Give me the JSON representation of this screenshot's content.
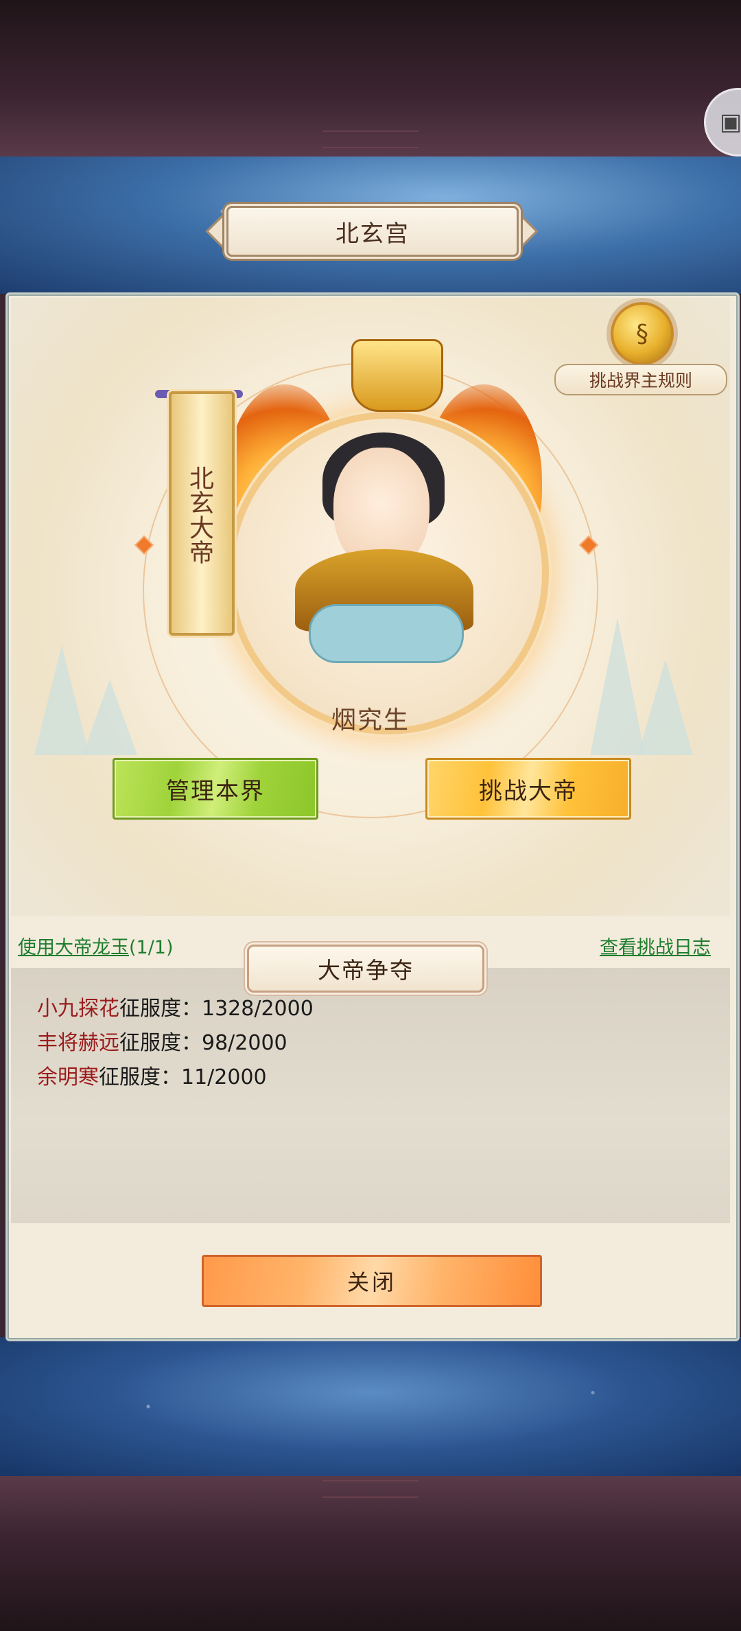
{
  "title": "北玄宫",
  "rules": {
    "icon": "scroll-rules-icon",
    "label": "挑战界主规则"
  },
  "ruler": {
    "title_banner": "北玄大帝",
    "name": "烟究生"
  },
  "actions": {
    "manage_label": "管理本界",
    "challenge_label": "挑战大帝"
  },
  "links": {
    "use_jade_label": "使用大帝龙玉",
    "use_jade_count": "(1/1)",
    "view_log_label": "查看挑战日志"
  },
  "contest": {
    "section_title": "大帝争夺",
    "entries": [
      {
        "name": "小九探花",
        "label": "征服度：",
        "progress": "1328/2000"
      },
      {
        "name": "丰将赫远",
        "label": "征服度：",
        "progress": "98/2000"
      },
      {
        "name": "余明寒",
        "label": "征服度：",
        "progress": "11/2000"
      }
    ]
  },
  "close_label": "关闭",
  "colors": {
    "accent_green": "#9fd33a",
    "accent_gold": "#ffc23a",
    "close_orange": "#ffb46a",
    "name_red": "#9b1c1c",
    "link_green": "#1e7d2e"
  }
}
